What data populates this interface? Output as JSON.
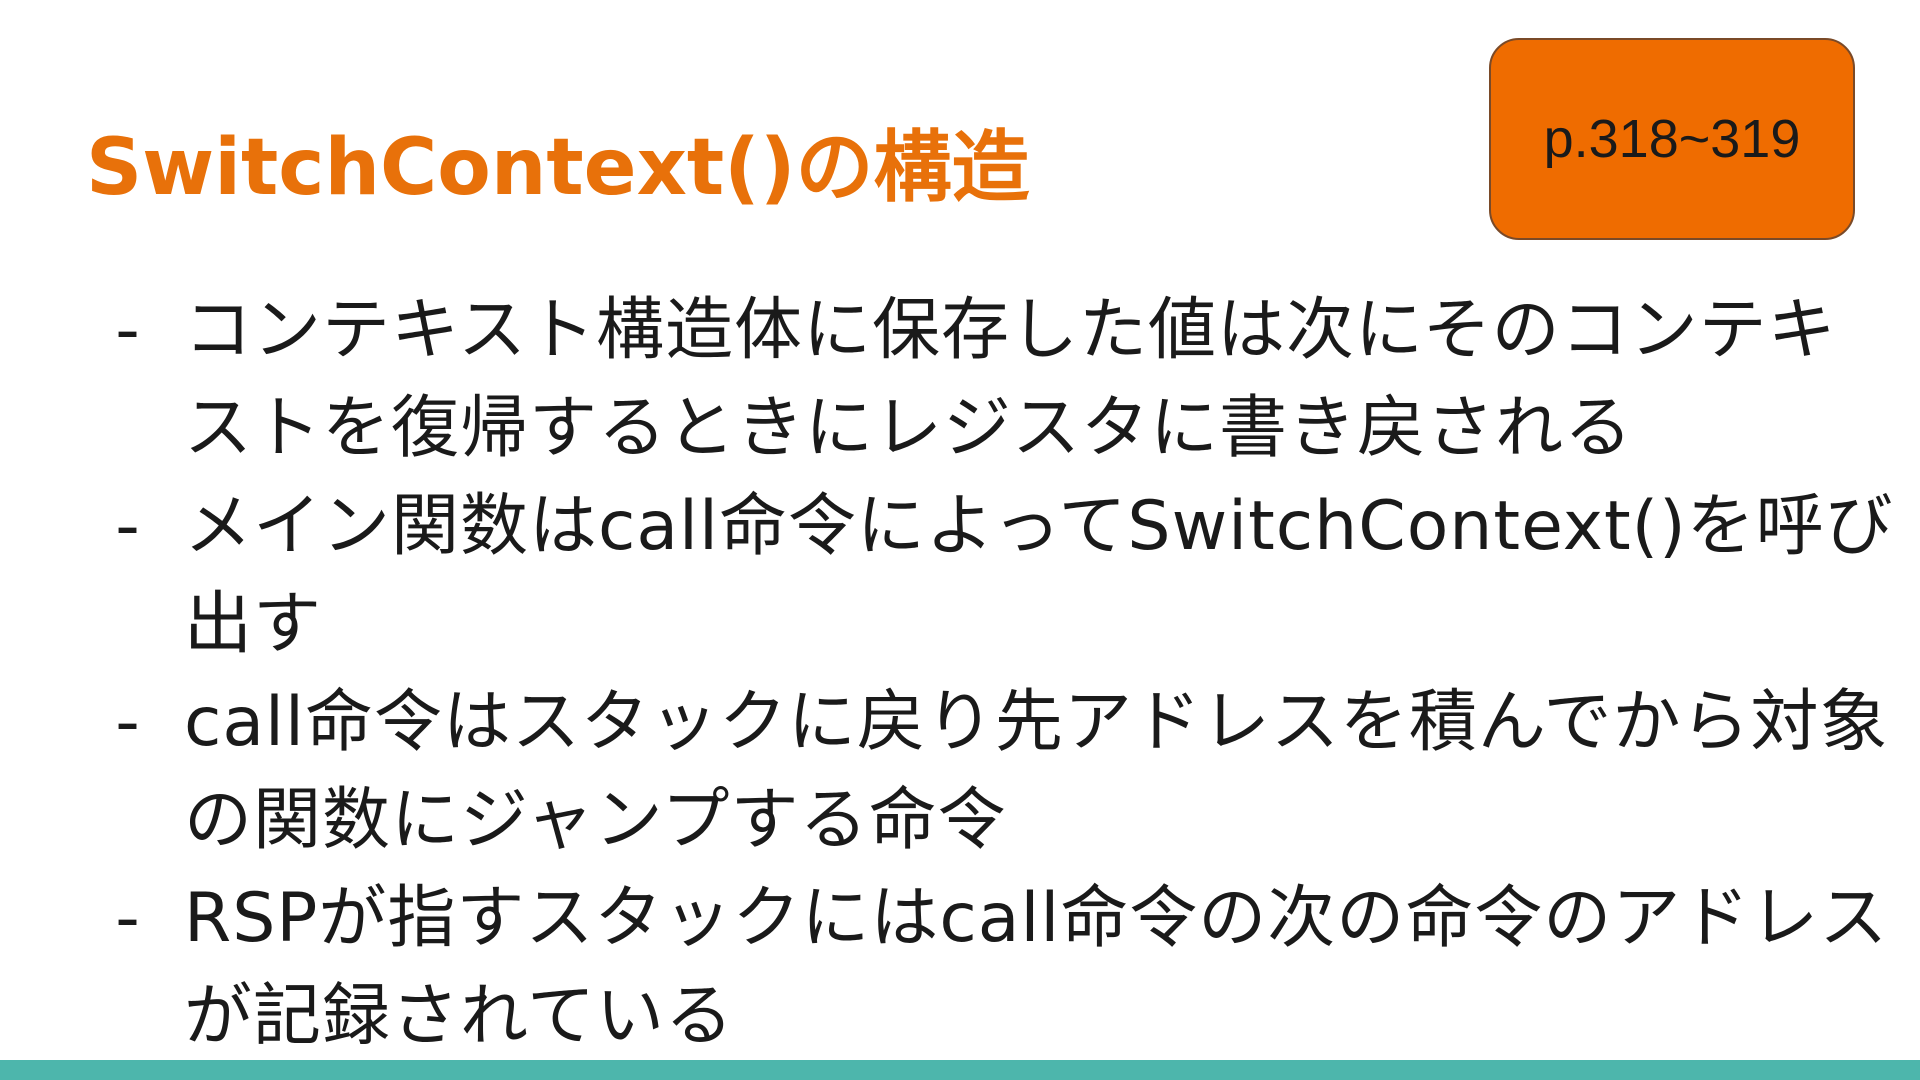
{
  "slide": {
    "title": "SwitchContext()の構造",
    "page_ref": "p.318~319",
    "bullet_marker": "-",
    "bullets": [
      {
        "text": "コンテキスト構造体に保存した値は次にそのコンテキストを復帰するときにレジスタに書き戻される"
      },
      {
        "text": "メイン関数はcall命令によってSwitchContext()を呼び出す"
      },
      {
        "text": "call命令はスタックに戻り先アドレスを積んでから対象の関数にジャンプする命令"
      },
      {
        "text": "RSPが指すスタックにはcall命令の次の命令のアドレスが記録されている"
      }
    ]
  },
  "colors": {
    "title": "#e8710a",
    "badge_fill": "#ef6c00",
    "bottom_bar": "#4db6ac"
  }
}
